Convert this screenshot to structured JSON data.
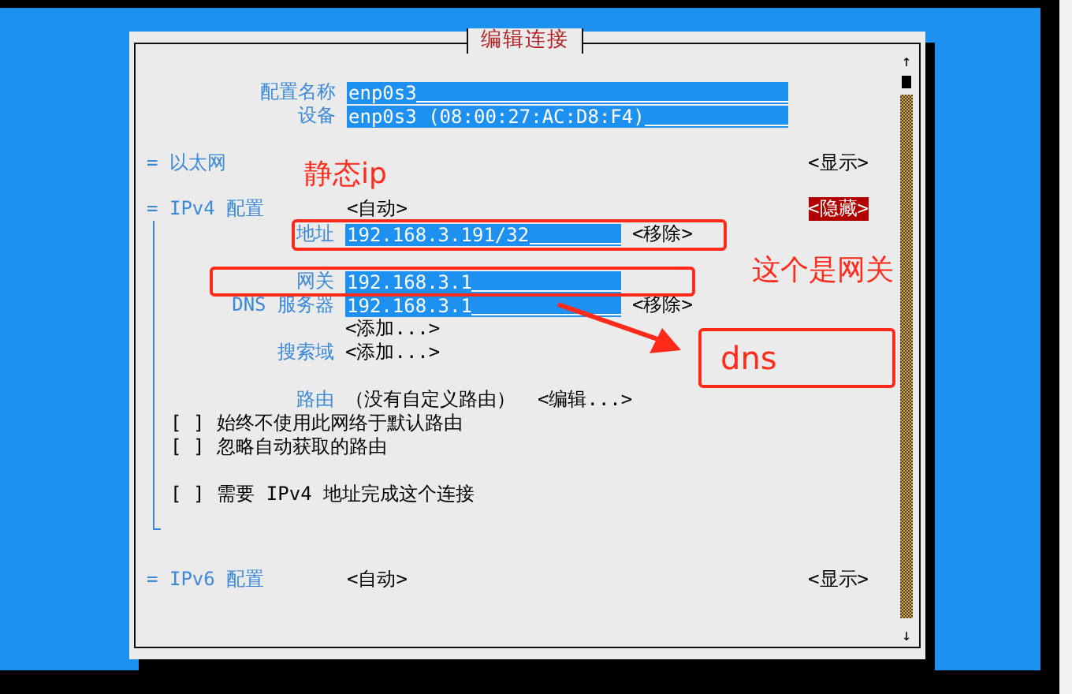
{
  "dialog": {
    "title": "编辑连接",
    "profile_name": {
      "label": "配置名称",
      "value": "enp0s3"
    },
    "device": {
      "label": "设备",
      "value": "enp0s3 (08:00:27:AC:D8:F4)"
    },
    "ethernet": {
      "marker": "=",
      "title": "以太网",
      "toggle": {
        "label": "<显示>",
        "selected": false
      }
    },
    "ipv4": {
      "marker": "=",
      "title": "IPv4 配置",
      "mode": "<自动>",
      "toggle": {
        "label": "<隐藏>",
        "selected": true
      },
      "addresses": {
        "label": "地址",
        "items": [
          {
            "value": "192.168.3.191/32",
            "remove": "<移除>"
          }
        ]
      },
      "gateway": {
        "label": "网关",
        "value": "192.168.3.1"
      },
      "dns": {
        "label": "DNS 服务器",
        "items": [
          {
            "value": "192.168.3.1",
            "remove": "<移除>"
          }
        ],
        "add": "<添加...>"
      },
      "search_domains": {
        "label": "搜索域",
        "add": "<添加...>"
      },
      "routing": {
        "label": "路由",
        "value": "（没有自定义路由）",
        "edit": "<编辑...>"
      },
      "options": [
        {
          "box": "[ ]",
          "label": "始终不使用此网络于默认路由",
          "checked": false
        },
        {
          "box": "[ ]",
          "label": "忽略自动获取的路由",
          "checked": false
        },
        {
          "box": "[ ]",
          "label": "需要 IPv4 地址完成这个连接",
          "checked": false
        }
      ]
    },
    "ipv6": {
      "marker": "=",
      "title": "IPv6 配置",
      "mode": "<自动>",
      "toggle": {
        "label": "<显示>",
        "selected": false
      }
    },
    "scrollbar": {
      "up": "↑",
      "down": "↓"
    }
  },
  "annotations": [
    {
      "kind": "text",
      "text": "静态ip"
    },
    {
      "kind": "box"
    },
    {
      "kind": "box"
    },
    {
      "kind": "text",
      "text": "这个是网关"
    },
    {
      "kind": "arrow"
    },
    {
      "kind": "boxed_text",
      "text": "dns"
    }
  ]
}
